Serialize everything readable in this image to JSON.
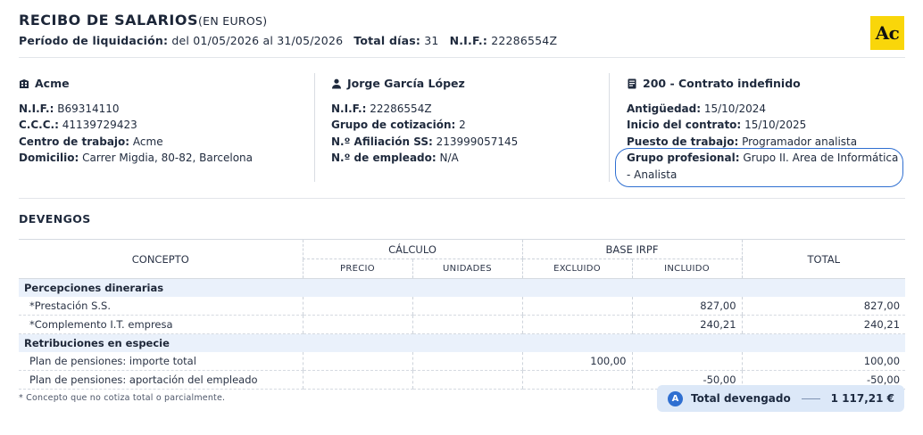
{
  "header": {
    "title": "RECIBO DE SALARIOS",
    "title_suffix": "(EN EUROS)",
    "period_label": "Período de liquidación:",
    "period_value": "del 01/05/2026 al 31/05/2026",
    "days_label": "Total días:",
    "days_value": "31",
    "nif_label": "N.I.F.:",
    "nif_value": "22286554Z",
    "logo_text": "Ac"
  },
  "company": {
    "name": "Acme",
    "rows": [
      {
        "label": "N.I.F.:",
        "value": "B69314110"
      },
      {
        "label": "C.C.C.:",
        "value": "41139729423"
      },
      {
        "label": "Centro de trabajo:",
        "value": "Acme"
      },
      {
        "label": "Domicilio:",
        "value": "Carrer Migdia, 80-82, Barcelona"
      }
    ]
  },
  "employee": {
    "name": "Jorge García López",
    "rows": [
      {
        "label": "N.I.F.:",
        "value": "22286554Z"
      },
      {
        "label": "Grupo de cotización:",
        "value": "2"
      },
      {
        "label": "N.º Afiliación SS:",
        "value": "213999057145"
      },
      {
        "label": "N.º de empleado:",
        "value": "N/A"
      }
    ]
  },
  "contract": {
    "name": "200 - Contrato indefinido",
    "rows": [
      {
        "label": "Antigüedad:",
        "value": "15/10/2024"
      },
      {
        "label": "Inicio del contrato:",
        "value": "15/10/2025"
      },
      {
        "label": "Puesto de trabajo:",
        "value": "Programador analista"
      }
    ],
    "group_label": "Grupo profesional:",
    "group_value": "Grupo II. Area de Informática - Analista"
  },
  "devengos": {
    "section_title": "DEVENGOS",
    "headers": {
      "concepto": "CONCEPTO",
      "calculo": "CÁLCULO",
      "base_irpf": "BASE IRPF",
      "total": "TOTAL",
      "precio": "PRECIO",
      "unidades": "UNIDADES",
      "excluido": "EXCLUIDO",
      "incluido": "INCLUIDO"
    },
    "groups": [
      {
        "name": "Percepciones dinerarias",
        "rows": [
          {
            "concepto": "*Prestación S.S.",
            "precio": "",
            "unidades": "",
            "excluido": "",
            "incluido": "827,00",
            "total": "827,00"
          },
          {
            "concepto": "*Complemento I.T. empresa",
            "precio": "",
            "unidades": "",
            "excluido": "",
            "incluido": "240,21",
            "total": "240,21"
          }
        ]
      },
      {
        "name": "Retribuciones en especie",
        "rows": [
          {
            "concepto": "Plan de pensiones: importe total",
            "precio": "",
            "unidades": "",
            "excluido": "100,00",
            "incluido": "",
            "total": "100,00"
          },
          {
            "concepto": "Plan de pensiones: aportación del empleado",
            "precio": "",
            "unidades": "",
            "excluido": "",
            "incluido": "-50,00",
            "total": "-50,00"
          }
        ]
      }
    ],
    "footnote": "* Concepto que no cotiza total o parcialmente.",
    "total_badge": "A",
    "total_label": "Total devengado",
    "total_value": "1 117,21 €"
  }
}
